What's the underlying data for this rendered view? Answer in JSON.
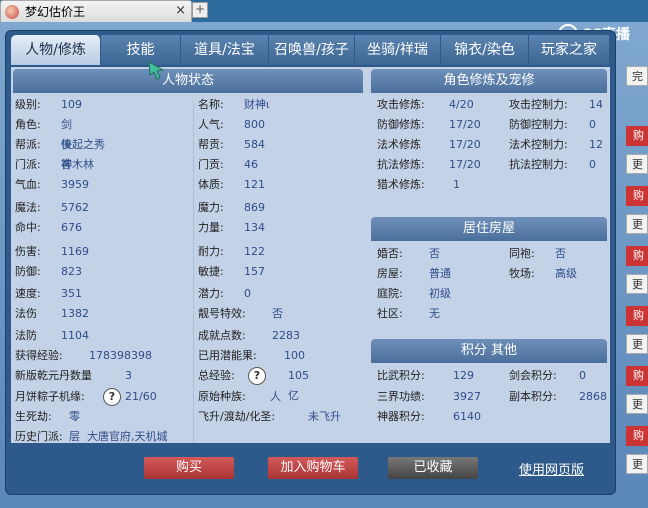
{
  "browser": {
    "tab_title": "梦幻估价王",
    "close_glyph": "×",
    "new_tab_glyph": "+"
  },
  "logo": {
    "text": "CC直播"
  },
  "tabs": [
    {
      "label": "人物/修炼",
      "active": true
    },
    {
      "label": "技能"
    },
    {
      "label": "道具/法宝"
    },
    {
      "label": "召唤兽/孩子"
    },
    {
      "label": "坐骑/祥瑞"
    },
    {
      "label": "锦衣/染色"
    },
    {
      "label": "玩家之家"
    }
  ],
  "left": {
    "title": "人物状态",
    "col1": [
      {
        "label": "级别:",
        "value": "109"
      },
      {
        "label": "角色:",
        "value": "剑侠客"
      },
      {
        "label": "帮派:",
        "value": "後起之秀"
      },
      {
        "label": "门派:",
        "value": "神木林"
      },
      {
        "label": "气血:",
        "value": "3959"
      },
      {
        "label": "魔法:",
        "value": "5762"
      },
      {
        "label": "命中:",
        "value": "676"
      },
      {
        "label": "伤害:",
        "value": "1169"
      },
      {
        "label": "防御:",
        "value": "823"
      },
      {
        "label": "速度:",
        "value": "351"
      },
      {
        "label": "法伤",
        "value": "1382"
      },
      {
        "label": "法防",
        "value": "1104"
      },
      {
        "label": "获得经验:",
        "value": "178398398"
      },
      {
        "label": "新版乾元丹数量",
        "value": "3"
      },
      {
        "label": "月饼粽子机缘:",
        "value": "21/60"
      },
      {
        "label": "生死劫:",
        "value": "零层"
      },
      {
        "label": "历史门派:",
        "value": "大唐官府,天机城"
      }
    ],
    "col2": [
      {
        "label": "名称:",
        "value": "财神ι"
      },
      {
        "label": "人气:",
        "value": "800"
      },
      {
        "label": "帮贡:",
        "value": "584"
      },
      {
        "label": "门贡:",
        "value": "46"
      },
      {
        "label": "体质:",
        "value": "121"
      },
      {
        "label": "魔力:",
        "value": "869"
      },
      {
        "label": "力量:",
        "value": "134"
      },
      {
        "label": "耐力:",
        "value": "122"
      },
      {
        "label": "敏捷:",
        "value": "157"
      },
      {
        "label": "潜力:",
        "value": "0"
      },
      {
        "label": "靓号特效:",
        "value": "否"
      },
      {
        "label": "成就点数:",
        "value": "2283"
      },
      {
        "label": "已用潜能果:",
        "value": "100"
      },
      {
        "label": "总经验:",
        "value": "105亿"
      },
      {
        "label": "原始种族:",
        "value": "人"
      },
      {
        "label": "飞升/渡劫/化圣:",
        "value": "未飞升"
      }
    ]
  },
  "cultivation": {
    "title": "角色修炼及宠修",
    "rows": [
      {
        "l1": "攻击修炼:",
        "v1": "4/20",
        "l2": "攻击控制力:",
        "v2": "14"
      },
      {
        "l1": "防御修炼:",
        "v1": "17/20",
        "l2": "防御控制力:",
        "v2": "0"
      },
      {
        "l1": "法术修炼",
        "v1": "17/20",
        "l2": "法术控制力:",
        "v2": "12"
      },
      {
        "l1": "抗法修炼:",
        "v1": "17/20",
        "l2": "抗法控制力:",
        "v2": "0"
      },
      {
        "l1": "猎术修炼:",
        "v1": "1",
        "l2": "",
        "v2": ""
      }
    ]
  },
  "housing": {
    "title": "居住房屋",
    "rows": [
      {
        "l1": "婚否:",
        "v1": "否",
        "l2": "同袍:",
        "v2": "否"
      },
      {
        "l1": "房屋:",
        "v1": "普通",
        "l2": "牧场:",
        "v2": "高级"
      },
      {
        "l1": "庭院:",
        "v1": "初级",
        "l2": "",
        "v2": ""
      },
      {
        "l1": "社区:",
        "v1": "无",
        "l2": "",
        "v2": ""
      }
    ]
  },
  "points": {
    "title": "积分 其他",
    "rows": [
      {
        "l1": "比武积分:",
        "v1": "129",
        "l2": "剑会积分:",
        "v2": "0"
      },
      {
        "l1": "三界功绩:",
        "v1": "3927",
        "l2": "副本积分:",
        "v2": "2868"
      },
      {
        "l1": "神器积分:",
        "v1": "6140",
        "l2": "",
        "v2": ""
      }
    ]
  },
  "footer": {
    "buy": "购买",
    "cart": "加入购物车",
    "fav": "已收藏",
    "web": "使用网页版"
  },
  "side": {
    "buy": "购",
    "more": "更",
    "top": "完"
  },
  "help_glyph": "?"
}
